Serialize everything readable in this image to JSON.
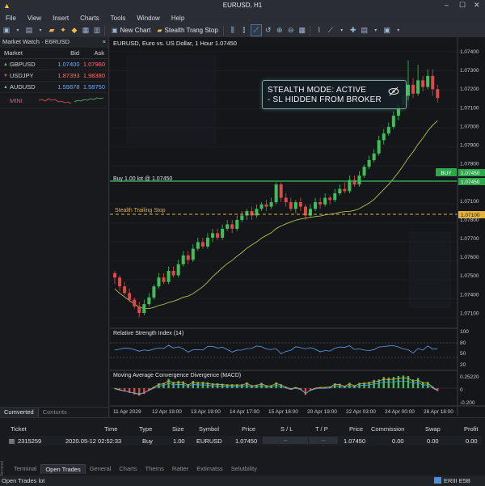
{
  "window": {
    "title": "EURUSD, H1",
    "min": "–",
    "max": "☐",
    "close": "✕"
  },
  "menu": [
    "File",
    "View",
    "Insert",
    "Charts",
    "Tools",
    "Window",
    "Help"
  ],
  "toolbar": {
    "new_chart": "New Chart",
    "stealth": "Stealth Trang Stop"
  },
  "market_watch": {
    "title": "Market Watch · E6RUSD",
    "close": "×",
    "columns": [
      "Market",
      "Bid",
      "Ask"
    ],
    "rows": [
      {
        "symbol": "GBPUSD",
        "bid": "1.07400",
        "ask": "1.07960",
        "bid_color": "#6fa8ff",
        "ask_color": "#ff6b6b",
        "arrow": "up"
      },
      {
        "symbol": "USDJPY",
        "bid": "1.87393",
        "ask": "1.98380",
        "bid_color": "#ff6b6b",
        "ask_color": "#ff6b6b",
        "arrow": "down"
      },
      {
        "symbol": "AUDUSD",
        "bid": "1.59878",
        "ask": "1.58750",
        "bid_color": "#6fa8ff",
        "ask_color": "#6fa8ff",
        "arrow": "up"
      },
      {
        "symbol": "MINI",
        "bid": "",
        "ask": "",
        "bid_color": "#cfd3da",
        "ask_color": "#cfd3da",
        "arrow": "none"
      }
    ],
    "tabs": [
      "Cumverted",
      "Contunts"
    ]
  },
  "chart": {
    "header": "EURUSD, Euro vs. US Dollar, 1 Hour 1.07450",
    "buy_line_label": "Buy 1.00 lot @ 1.07450",
    "trailing_label": "Stealth Trailing Stop",
    "buy_tag": "BUY",
    "buy_price_tag": "1.07450",
    "stop_price_tag": "1.07100",
    "current_tag": "1.07450",
    "stealth_line1": "STEALTH MODE: ACTIVE",
    "stealth_line2": "- SL HIDDEN FROM BROKER",
    "rsi_title": "Relative Strength Index (14)",
    "macd_title": "Moving Average Convergence Divergence (MACD)",
    "price_axis": [
      "1.07400",
      "1.07300",
      "1.07200",
      "1.07100",
      "1.07000",
      "1.07900",
      "1.07800",
      "1.07300",
      "1.07100",
      "1.07800",
      "1.07700",
      "1.07600",
      "1.07500",
      "1.07400",
      "1.07100"
    ],
    "rsi_axis": [
      "100",
      "80",
      "50",
      "20"
    ],
    "macd_axis": [
      "0.25220",
      "0",
      "-0.200"
    ],
    "time_axis": [
      "11 Apr 2029",
      "12 Apr 19:00",
      "13 Apr 19:00",
      "14 Apr 17:00",
      "15 Apr 18:00",
      "20 Apr 19:00",
      "22 Apr 03:00",
      "24 Apr 00:00",
      "26 Apr 18:00"
    ]
  },
  "chart_data": {
    "type": "candlestick",
    "symbol": "EURUSD",
    "timeframe": "H1",
    "price_axis_labels": [
      "1.07400",
      "1.07300",
      "1.07200",
      "1.07100",
      "1.07000",
      "1.07900",
      "1.07800",
      "1.07300",
      "1.07100",
      "1.07800",
      "1.07700",
      "1.07600",
      "1.07500",
      "1.07400",
      "1.07100"
    ],
    "x_axis_labels": [
      "11 Apr 2029",
      "12 Apr 19:00",
      "13 Apr 19:00",
      "14 Apr 17:00",
      "15 Apr 18:00",
      "20 Apr 19:00",
      "22 Apr 03:00",
      "24 Apr 00:00",
      "26 Apr 18:00"
    ],
    "candles": [
      {
        "o": 0.42,
        "c": 0.4,
        "h": 0.43,
        "l": 0.37
      },
      {
        "o": 0.4,
        "c": 0.36,
        "h": 0.41,
        "l": 0.34
      },
      {
        "o": 0.36,
        "c": 0.33,
        "h": 0.38,
        "l": 0.32
      },
      {
        "o": 0.33,
        "c": 0.3,
        "h": 0.35,
        "l": 0.29
      },
      {
        "o": 0.3,
        "c": 0.27,
        "h": 0.31,
        "l": 0.26
      },
      {
        "o": 0.27,
        "c": 0.24,
        "h": 0.29,
        "l": 0.22
      },
      {
        "o": 0.24,
        "c": 0.28,
        "h": 0.3,
        "l": 0.23
      },
      {
        "o": 0.28,
        "c": 0.31,
        "h": 0.33,
        "l": 0.27
      },
      {
        "o": 0.31,
        "c": 0.36,
        "h": 0.37,
        "l": 0.3
      },
      {
        "o": 0.36,
        "c": 0.4,
        "h": 0.42,
        "l": 0.35
      },
      {
        "o": 0.4,
        "c": 0.38,
        "h": 0.42,
        "l": 0.37
      },
      {
        "o": 0.38,
        "c": 0.43,
        "h": 0.45,
        "l": 0.37
      },
      {
        "o": 0.43,
        "c": 0.41,
        "h": 0.45,
        "l": 0.4
      },
      {
        "o": 0.41,
        "c": 0.46,
        "h": 0.48,
        "l": 0.4
      },
      {
        "o": 0.46,
        "c": 0.5,
        "h": 0.52,
        "l": 0.45
      },
      {
        "o": 0.5,
        "c": 0.48,
        "h": 0.52,
        "l": 0.46
      },
      {
        "o": 0.48,
        "c": 0.53,
        "h": 0.55,
        "l": 0.47
      },
      {
        "o": 0.53,
        "c": 0.56,
        "h": 0.58,
        "l": 0.52
      },
      {
        "o": 0.56,
        "c": 0.54,
        "h": 0.58,
        "l": 0.53
      },
      {
        "o": 0.54,
        "c": 0.58,
        "h": 0.6,
        "l": 0.53
      },
      {
        "o": 0.58,
        "c": 0.6,
        "h": 0.62,
        "l": 0.56
      },
      {
        "o": 0.6,
        "c": 0.58,
        "h": 0.62,
        "l": 0.57
      },
      {
        "o": 0.58,
        "c": 0.62,
        "h": 0.64,
        "l": 0.57
      },
      {
        "o": 0.62,
        "c": 0.64,
        "h": 0.66,
        "l": 0.61
      },
      {
        "o": 0.64,
        "c": 0.62,
        "h": 0.66,
        "l": 0.6
      },
      {
        "o": 0.62,
        "c": 0.66,
        "h": 0.68,
        "l": 0.61
      },
      {
        "o": 0.66,
        "c": 0.68,
        "h": 0.7,
        "l": 0.65
      },
      {
        "o": 0.68,
        "c": 0.7,
        "h": 0.71,
        "l": 0.66
      },
      {
        "o": 0.7,
        "c": 0.68,
        "h": 0.72,
        "l": 0.66
      },
      {
        "o": 0.68,
        "c": 0.71,
        "h": 0.73,
        "l": 0.67
      },
      {
        "o": 0.71,
        "c": 0.73,
        "h": 0.74,
        "l": 0.7
      },
      {
        "o": 0.73,
        "c": 0.72,
        "h": 0.75,
        "l": 0.7
      },
      {
        "o": 0.72,
        "c": 0.74,
        "h": 0.76,
        "l": 0.71
      },
      {
        "o": 0.74,
        "c": 0.82,
        "h": 0.83,
        "l": 0.73
      },
      {
        "o": 0.82,
        "c": 0.76,
        "h": 0.83,
        "l": 0.74
      },
      {
        "o": 0.76,
        "c": 0.74,
        "h": 0.78,
        "l": 0.72
      },
      {
        "o": 0.74,
        "c": 0.71,
        "h": 0.76,
        "l": 0.7
      },
      {
        "o": 0.71,
        "c": 0.74,
        "h": 0.75,
        "l": 0.69
      },
      {
        "o": 0.74,
        "c": 0.72,
        "h": 0.76,
        "l": 0.7
      },
      {
        "o": 0.72,
        "c": 0.68,
        "h": 0.73,
        "l": 0.66
      },
      {
        "o": 0.68,
        "c": 0.71,
        "h": 0.73,
        "l": 0.67
      },
      {
        "o": 0.71,
        "c": 0.74,
        "h": 0.76,
        "l": 0.7
      },
      {
        "o": 0.74,
        "c": 0.73,
        "h": 0.76,
        "l": 0.71
      },
      {
        "o": 0.73,
        "c": 0.76,
        "h": 0.78,
        "l": 0.72
      },
      {
        "o": 0.76,
        "c": 0.75,
        "h": 0.77,
        "l": 0.73
      },
      {
        "o": 0.75,
        "c": 0.78,
        "h": 0.8,
        "l": 0.74
      },
      {
        "o": 0.78,
        "c": 0.8,
        "h": 0.82,
        "l": 0.77
      },
      {
        "o": 0.8,
        "c": 0.79,
        "h": 0.83,
        "l": 0.78
      },
      {
        "o": 0.79,
        "c": 0.84,
        "h": 0.86,
        "l": 0.78
      },
      {
        "o": 0.84,
        "c": 0.82,
        "h": 0.86,
        "l": 0.81
      },
      {
        "o": 0.82,
        "c": 0.86,
        "h": 0.88,
        "l": 0.81
      },
      {
        "o": 0.86,
        "c": 0.9,
        "h": 0.91,
        "l": 0.85
      },
      {
        "o": 0.9,
        "c": 0.93,
        "h": 0.95,
        "l": 0.89
      },
      {
        "o": 0.93,
        "c": 0.96,
        "h": 0.98,
        "l": 0.92
      },
      {
        "o": 0.96,
        "c": 1.02,
        "h": 1.04,
        "l": 0.95
      },
      {
        "o": 1.02,
        "c": 1.05,
        "h": 1.07,
        "l": 1.0
      },
      {
        "o": 1.05,
        "c": 1.08,
        "h": 1.1,
        "l": 1.04
      },
      {
        "o": 1.08,
        "c": 1.13,
        "h": 1.15,
        "l": 1.07
      },
      {
        "o": 1.13,
        "c": 1.18,
        "h": 1.19,
        "l": 1.11
      },
      {
        "o": 1.18,
        "c": 1.22,
        "h": 1.25,
        "l": 1.16
      },
      {
        "o": 1.22,
        "c": 1.27,
        "h": 1.38,
        "l": 1.2
      },
      {
        "o": 1.27,
        "c": 1.23,
        "h": 1.3,
        "l": 1.21
      },
      {
        "o": 1.23,
        "c": 1.29,
        "h": 1.36,
        "l": 1.22
      },
      {
        "o": 1.29,
        "c": 1.26,
        "h": 1.31,
        "l": 1.24
      },
      {
        "o": 1.26,
        "c": 1.31,
        "h": 1.34,
        "l": 1.25
      },
      {
        "o": 1.31,
        "c": 1.25,
        "h": 1.34,
        "l": 1.22
      },
      {
        "o": 1.25,
        "c": 1.21,
        "h": 1.27,
        "l": 1.19
      }
    ],
    "buy_level": 0.92,
    "stop_level": 0.72,
    "rsi_levels": [
      80,
      50,
      20
    ]
  },
  "terminal": {
    "headers": [
      "Ticket",
      "Time",
      "Type",
      "Size",
      "Symbol",
      "Price",
      "S / L",
      "T / P",
      "Price",
      "Commission",
      "Swap",
      "Profit"
    ],
    "row": [
      "2315259",
      "2020.05-12 02:52:33",
      "Buy",
      "1.00",
      "EURUSD",
      "1.07450",
      "--",
      "--",
      "1.07450",
      "0.00",
      "0.00",
      "0.00"
    ],
    "tabs": [
      "Terminal",
      "Open Trades",
      "General",
      "Charts",
      "Therns",
      "Ratter",
      "Extimatss",
      "Selutbility"
    ],
    "side": "Terminal",
    "status_left": "Open Trades lot",
    "status_right": "ERIII E5B"
  }
}
